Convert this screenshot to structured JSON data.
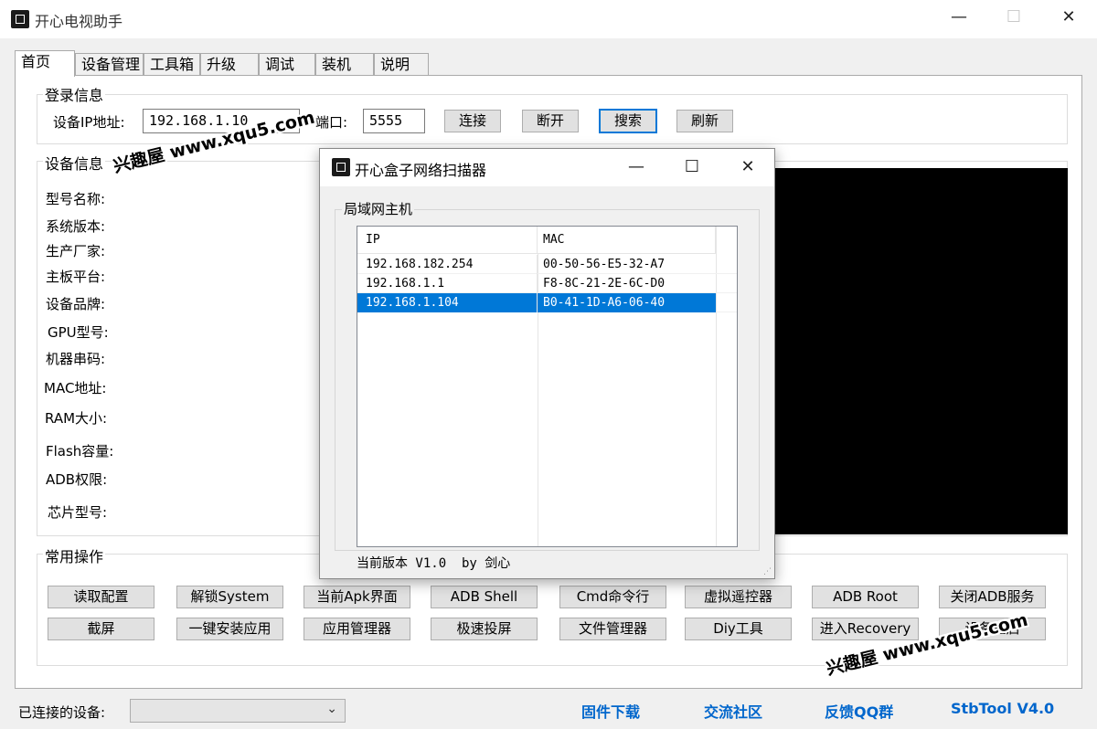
{
  "window": {
    "title": "开心电视助手",
    "icon": "chip-icon",
    "controls": {
      "minimize": "—",
      "maximize": "☐",
      "close": "✕"
    }
  },
  "tabs": [
    {
      "label": "首页",
      "active": true
    },
    {
      "label": "设备管理"
    },
    {
      "label": "工具箱"
    },
    {
      "label": "升级"
    },
    {
      "label": "调试"
    },
    {
      "label": "装机"
    },
    {
      "label": "说明"
    }
  ],
  "login": {
    "title": "登录信息",
    "ip_label": "设备IP地址:",
    "ip_value": "192.168.1.10",
    "port_label": "端口:",
    "port_value": "5555",
    "buttons": {
      "connect": "连接",
      "disconnect": "断开",
      "search": "搜索",
      "refresh": "刷新"
    }
  },
  "device_info": {
    "title": "设备信息",
    "fields": [
      "型号名称:",
      "系统版本:",
      "生产厂家:",
      "主板平台:",
      "设备品牌:",
      "GPU型号:",
      "机器串码:",
      "MAC地址:",
      "RAM大小:",
      "Flash容量:",
      "ADB权限:",
      "芯片型号:"
    ]
  },
  "ops": {
    "title": "常用操作",
    "row1": [
      "读取配置",
      "解锁System",
      "当前Apk界面",
      "ADB Shell",
      "Cmd命令行",
      "虚拟遥控器",
      "ADB  Root",
      "关闭ADB服务"
    ],
    "row2": [
      "截屏",
      "一键安装应用",
      "应用管理器",
      "极速投屏",
      "文件管理器",
      "Diy工具",
      "进入Recovery",
      "设备重启"
    ]
  },
  "footer": {
    "connected_label": "已连接的设备:",
    "device_select": "",
    "links": [
      "固件下载",
      "交流社区",
      "反馈QQ群",
      "StbTool V4.0"
    ]
  },
  "dialog": {
    "title": "开心盒子网络扫描器",
    "icon": "chip-icon",
    "controls": {
      "minimize": "—",
      "maximize": "☐",
      "close": "✕"
    },
    "group_title": "局域网主机",
    "columns": [
      "IP",
      "MAC"
    ],
    "rows": [
      {
        "ip": "192.168.182.254",
        "mac": "00-50-56-E5-32-A7"
      },
      {
        "ip": "192.168.1.1",
        "mac": "F8-8C-21-2E-6C-D0"
      },
      {
        "ip": "192.168.1.104",
        "mac": "B0-41-1D-A6-06-40",
        "selected": true
      }
    ],
    "status": "当前版本 V1.0  by 剑心"
  },
  "watermarks": [
    "兴趣屋 www.xqu5.com",
    "兴趣屋 www.xqu5.com"
  ],
  "colors": {
    "accent": "#0078d7",
    "link": "#0066cc",
    "preview": "#000000"
  }
}
